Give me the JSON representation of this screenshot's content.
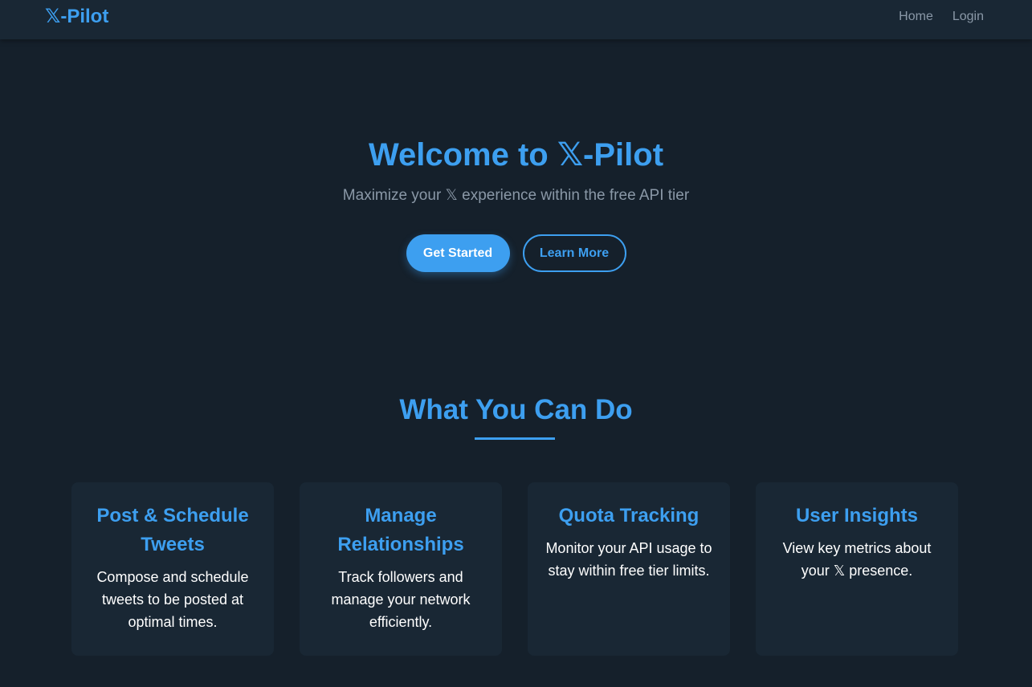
{
  "nav": {
    "brand": "𝕏-Pilot",
    "links": [
      "Home",
      "Login"
    ]
  },
  "hero": {
    "title": "Welcome to 𝕏-Pilot",
    "subtitle": "Maximize your 𝕏 experience within the free API tier",
    "primary_button": "Get Started",
    "secondary_button": "Learn More"
  },
  "features": {
    "title": "What You Can Do",
    "cards": [
      {
        "title": "Post & Schedule Tweets",
        "description": "Compose and schedule tweets to be posted at optimal times."
      },
      {
        "title": "Manage Relationships",
        "description": "Track followers and manage your network efficiently."
      },
      {
        "title": "Quota Tracking",
        "description": "Monitor your API usage to stay within free tier limits."
      },
      {
        "title": "User Insights",
        "description": "View key metrics about your 𝕏 presence."
      }
    ]
  },
  "colors": {
    "background": "#15202b",
    "surface": "#192734",
    "accent": "#3d9ff0",
    "muted_text": "#8a98a7"
  }
}
